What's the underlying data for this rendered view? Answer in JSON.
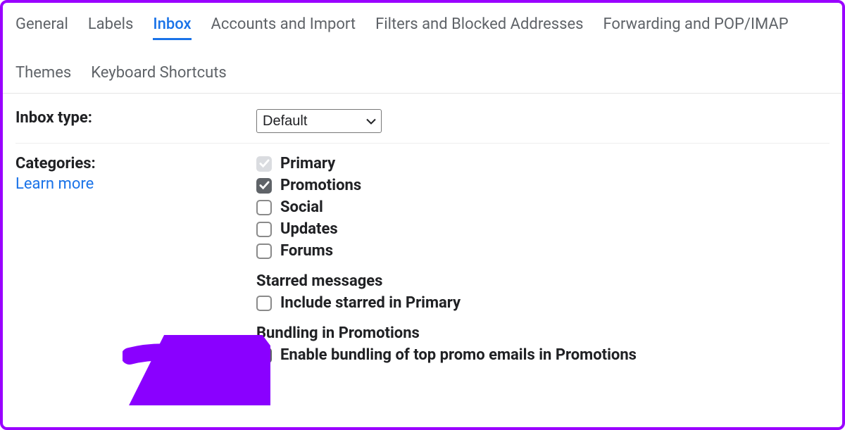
{
  "tabs": {
    "general": "General",
    "labels": "Labels",
    "inbox": "Inbox",
    "accounts": "Accounts and Import",
    "filters": "Filters and Blocked Addresses",
    "forwarding": "Forwarding and POP/IMAP",
    "themes": "Themes",
    "shortcuts": "Keyboard Shortcuts"
  },
  "inbox_type": {
    "label": "Inbox type:",
    "value": "Default"
  },
  "categories": {
    "label": "Categories:",
    "learn_more": "Learn more",
    "items": {
      "primary": "Primary",
      "promotions": "Promotions",
      "social": "Social",
      "updates": "Updates",
      "forums": "Forums"
    }
  },
  "starred": {
    "heading": "Starred messages",
    "include_label": "Include starred in Primary"
  },
  "bundling": {
    "heading": "Bundling in Promotions",
    "enable_label": "Enable bundling of top promo emails in Promotions"
  }
}
